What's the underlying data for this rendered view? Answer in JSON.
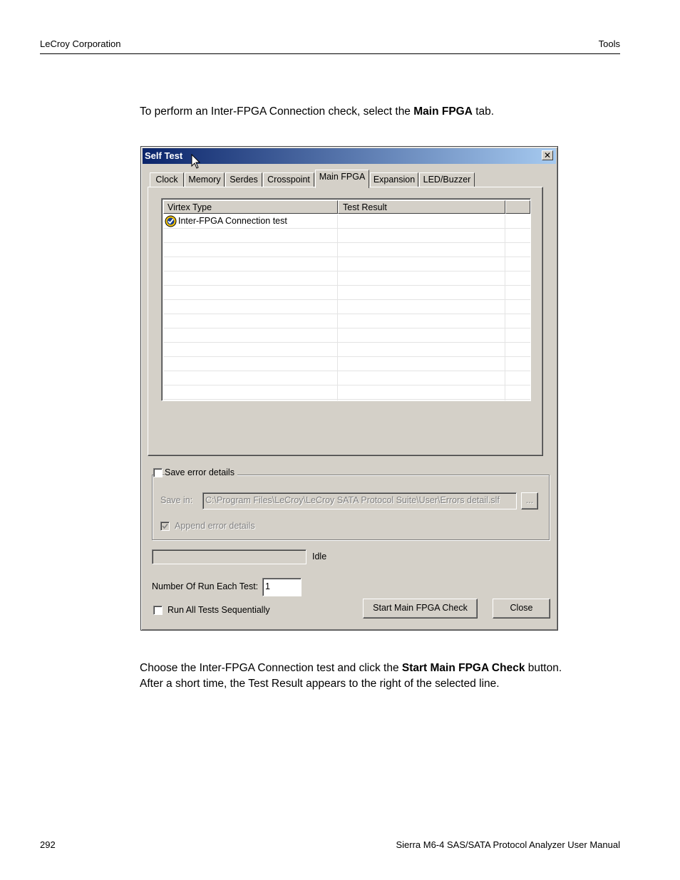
{
  "header": {
    "left": "LeCroy Corporation",
    "right": "Tools"
  },
  "intro": {
    "before": "To perform an Inter-FPGA Connection check, select the ",
    "bold": "Main FPGA",
    "after": " tab."
  },
  "dialog": {
    "title": "Self Test",
    "close_glyph": "✕",
    "tabs": [
      "Clock",
      "Memory",
      "Serdes",
      "Crosspoint",
      "Main FPGA",
      "Expansion",
      "LED/Buzzer"
    ],
    "active_tab": "Main FPGA",
    "list": {
      "columns": [
        "Virtex Type",
        "Test Result"
      ],
      "rows": [
        {
          "name": "Inter-FPGA Connection test",
          "result": ""
        }
      ]
    },
    "save_error_details": {
      "label": "Save error details",
      "checked": false
    },
    "save_in": {
      "label": "Save in:",
      "value": "C:\\Program Files\\LeCroy\\LeCroy SATA Protocol Suite\\User\\Errors detail.slf",
      "browse_label": "..."
    },
    "append_error_details": {
      "label": "Append error details",
      "checked": true
    },
    "progress": {
      "value": 0,
      "status": "Idle"
    },
    "runs": {
      "label": "Number Of Run Each Test:",
      "value": "1"
    },
    "run_all": {
      "label": "Run All Tests Sequentially",
      "checked": false
    },
    "start_button": "Start Main FPGA Check",
    "close_button": "Close"
  },
  "outro": {
    "line1_before": "Choose the Inter-FPGA Connection test and click the ",
    "line1_bold": "Start Main FPGA Check",
    "line1_after": " button.",
    "line2": "After a short time, the Test Result appears to the right of the selected line."
  },
  "footer": {
    "left": "292",
    "right": "Sierra M6-4 SAS/SATA Protocol Analyzer User Manual"
  },
  "colors": {
    "titlebar_start": "#0a246a",
    "titlebar_end": "#a6caf0",
    "dialog_face": "#d4d0c8"
  }
}
